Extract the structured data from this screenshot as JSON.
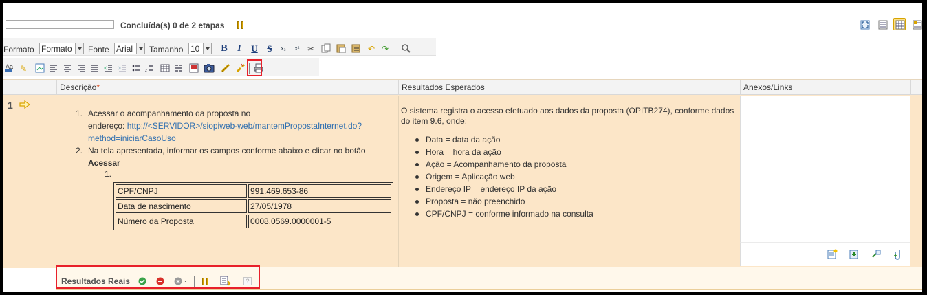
{
  "progress": {
    "label": "Concluída(s) 0 de 2 etapas",
    "value": 0
  },
  "toolbar": {
    "format_label": "Formato",
    "format_value": "Formato",
    "font_label": "Fonte",
    "font_value": "Arial",
    "size_label": "Tamanho",
    "size_value": "10",
    "bold": "B",
    "italic": "I",
    "underline": "U",
    "strike": "S"
  },
  "columns": {
    "description": "Descrição",
    "required_mark": "*",
    "expected": "Resultados Esperados",
    "attachments": "Anexos/Links"
  },
  "row": {
    "number": "1",
    "steps": [
      {
        "n": "1.",
        "text_a": "Acessar o acompanhamento da proposta no",
        "text_b": "endereço: ",
        "link_a": "http://<SERVIDOR>/siopiweb-web/mantemPropostaInternet.do?",
        "link_b": "method=iniciarCasoUso"
      },
      {
        "n": "2.",
        "text_a": "Na tela apresentada, informar os campos conforme abaixo e clicar no botão",
        "text_b": "Acessar"
      }
    ],
    "sub_number": "1.",
    "table": [
      {
        "field": "CPF/CNPJ",
        "value": "991.469.653-86"
      },
      {
        "field": "Data de nascimento",
        "value": "27/05/1978"
      },
      {
        "field": "Número da Proposta",
        "value": "0008.0569.0000001-5"
      }
    ],
    "expected_intro": "O sistema registra o acesso efetuado aos dados da proposta (OPITB274), conforme dados do item 9.6, onde:",
    "expected_items": [
      "Data = data da ação",
      "Hora = hora da ação",
      "Ação = Acompanhamento da proposta",
      "Origem = Aplicação web",
      "Endereço IP = endereço IP da ação",
      "Proposta = não preenchido",
      "CPF/CNPJ = conforme informado na consulta"
    ]
  },
  "results": {
    "label": "Resultados Reais",
    "help": "?"
  },
  "colors": {
    "row_bg": "#fce6c8",
    "highlight": "#e8202a",
    "accent": "#d9a400",
    "link": "#2f6fb0"
  }
}
